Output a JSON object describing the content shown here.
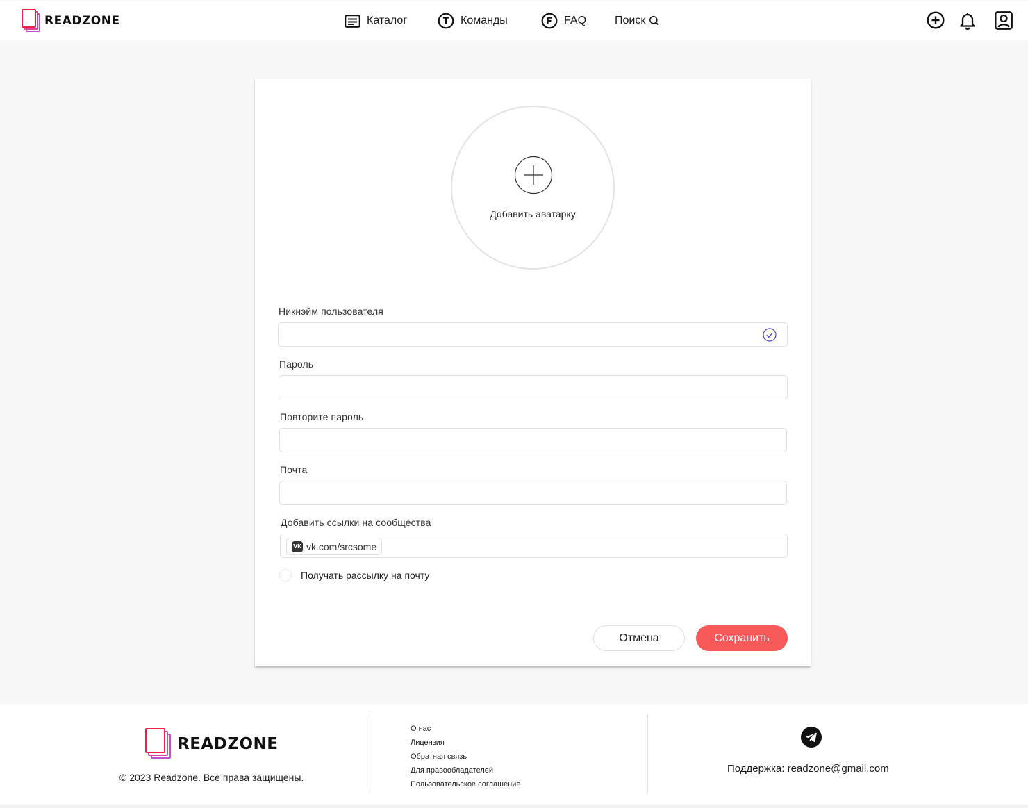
{
  "brand": {
    "name": "READZONE",
    "colors": {
      "accent": "#f85a5a",
      "logo_front": "#e8224d",
      "logo_back": "#c14fd6",
      "check": "#4a3fd1"
    }
  },
  "nav": {
    "catalog": {
      "label": "Каталог",
      "icon": "catalog-icon"
    },
    "teams": {
      "label": "Команды",
      "icon": "teams-circle-t-icon"
    },
    "faq": {
      "label": "FAQ",
      "icon": "faq-circle-f-icon"
    },
    "search": {
      "label": "Поиск",
      "icon": "search-icon"
    }
  },
  "header_actions": [
    "add-circle-icon",
    "bell-icon",
    "profile-icon"
  ],
  "form": {
    "avatar_label": "Добавить аватарку",
    "nickname": {
      "label": "Никнэйм пользователя",
      "value": "",
      "valid": true
    },
    "password": {
      "label": "Пароль",
      "value": ""
    },
    "password_repeat": {
      "label": "Повторите пароль",
      "value": ""
    },
    "email": {
      "label": "Почта",
      "value": ""
    },
    "links": {
      "label": "Добавить ссылки на сообщества",
      "chips": [
        {
          "icon": "vk-icon",
          "badge": "VK",
          "text": "vk.com/srcsome"
        }
      ]
    },
    "newsletter": {
      "label": "Получать рассылку на почту",
      "checked": false
    },
    "cancel_label": "Отмена",
    "save_label": "Сохранить"
  },
  "footer": {
    "copyright": "© 2023 Readzone. Все права защищены.",
    "links": [
      "О нас",
      "Лицензия",
      "Обратная связь",
      "Для правообладателей",
      "Пользовательское соглашение"
    ],
    "support": "Поддержка: readzone@gmail.com",
    "social_icon": "telegram-icon"
  }
}
